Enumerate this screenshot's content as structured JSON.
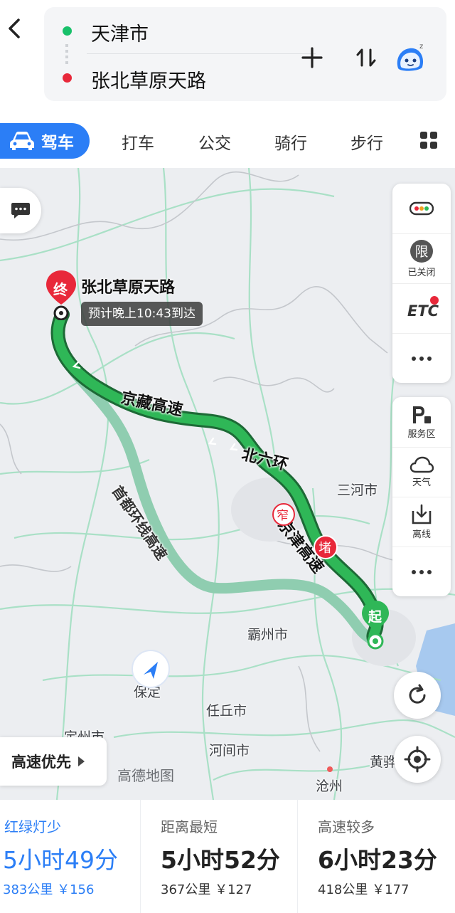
{
  "header": {
    "origin": "天津市",
    "destination": "张北草原天路"
  },
  "tabs": {
    "active": "驾车",
    "items": [
      "打车",
      "公交",
      "骑行",
      "步行"
    ]
  },
  "map": {
    "destination_marker": "终",
    "destination_name": "张北草原天路",
    "eta": "预计晚上10:43到达",
    "start_marker": "起",
    "road_labels": {
      "road1": [
        "京",
        "藏",
        "高",
        "速"
      ],
      "road2": [
        "北",
        "六",
        "环"
      ],
      "road3": [
        "京",
        "津",
        "高",
        "速"
      ],
      "alt": [
        "首",
        "都",
        "环",
        "线",
        "高",
        "速"
      ]
    },
    "badges": {
      "narrow": "窄",
      "jam": "堵"
    },
    "places": [
      "三河市",
      "霸州市",
      "保定",
      "任丘市",
      "定州市",
      "河间市",
      "黄骅",
      "沧州"
    ],
    "side_panel_top": [
      {
        "label": "",
        "icon": "traffic-light-icon"
      },
      {
        "label": "已关闭",
        "badge": "限",
        "icon": "restriction-icon"
      },
      {
        "label": "",
        "badge": "ETC",
        "icon": "etc-icon"
      },
      {
        "label": "",
        "icon": "more-icon"
      }
    ],
    "side_panel_bottom": [
      {
        "label": "服务区",
        "icon": "service-area-icon"
      },
      {
        "label": "天气",
        "icon": "weather-icon"
      },
      {
        "label": "离线",
        "icon": "offline-icon"
      },
      {
        "label": "",
        "icon": "more-icon"
      }
    ],
    "route_preference": "高速优先",
    "watermark": "高德地图",
    "colors": {
      "route_main": "#2fb757",
      "route_alt": "#8fcdb0",
      "accent": "#2b7ef6"
    }
  },
  "routes": [
    {
      "name": "红绿灯少",
      "time": "5小时49分",
      "distance": "383公里",
      "toll": "￥156",
      "active": true
    },
    {
      "name": "距离最短",
      "time": "5小时52分",
      "distance": "367公里",
      "toll": "￥127",
      "active": false
    },
    {
      "name": "高速较多",
      "time": "6小时23分",
      "distance": "418公里",
      "toll": "￥177",
      "active": false
    }
  ]
}
